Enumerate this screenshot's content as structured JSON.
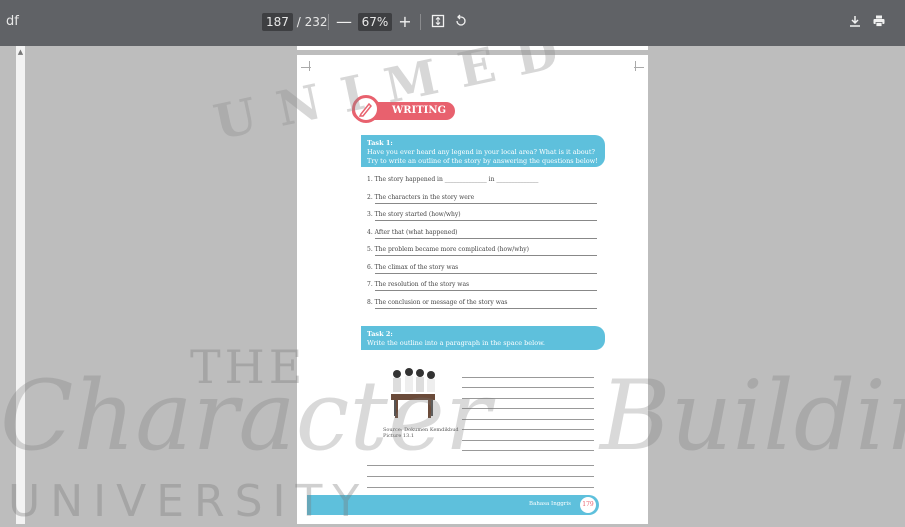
{
  "toolbar": {
    "title": "df",
    "current_page": "187",
    "page_separator": "/",
    "total_pages": "232",
    "zoom_out": "—",
    "zoom": "67%",
    "zoom_in": "+",
    "fit_icon": "fit-page-icon",
    "rotate_icon": "rotate-icon",
    "download_icon": "download-icon",
    "print_icon": "print-icon"
  },
  "document": {
    "section_heading": "WRITING",
    "task1_title": "Task 1:",
    "task1_text": "Have you ever heard any legend in your local area? What is it about? Try to write an outline of the story by answering the questions below!",
    "questions": [
      "1.  The story happened in ______________ in ______________",
      "2.  The characters in the story were",
      "3.  The story started (how/why)",
      "4.  After that (what happened)",
      "5.  The problem became more complicated (how/why)",
      "6.  The climax of the story was",
      "7.  The resolution of the story was",
      "8.  The conclusion or message of the story was"
    ],
    "task2_title": "Task 2:",
    "task2_text": "Write the outline into a paragraph in the space below.",
    "caption": "Source: Dokumen Kemdikbud Picture 13.1",
    "footer_text": "Bahasa Inggris",
    "footer_page": "179"
  },
  "watermark": {
    "top": "UNIMED",
    "the": "THE",
    "script_left": "Character",
    "script_right": "Building",
    "university": "UNIVERSITY"
  }
}
